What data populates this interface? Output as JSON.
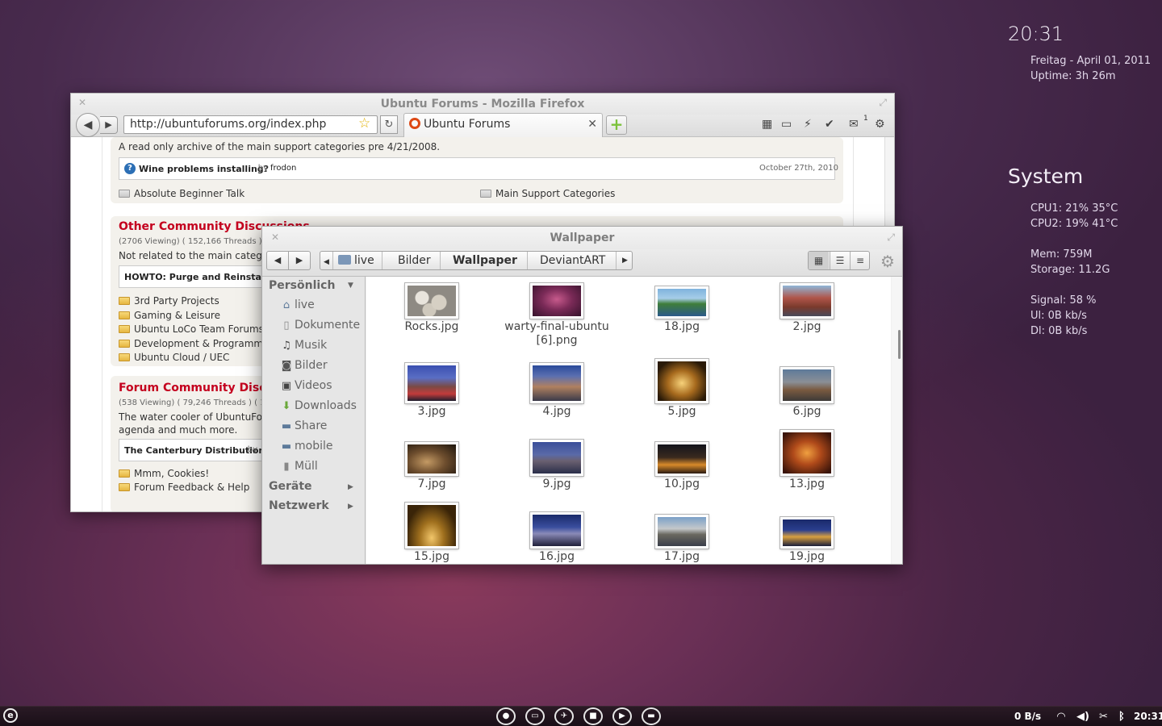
{
  "conky": {
    "clock": "20:31",
    "date": "Freitag - April 01, 2011",
    "uptime": "Uptime: 3h 26m",
    "system_title": "System",
    "cpu1": "CPU1: 21%  35°C",
    "cpu2": "CPU2: 19%  41°C",
    "mem": "Mem: 759M",
    "storage": "Storage: 11.2G",
    "signal": "Signal: 58  %",
    "ul": "Ul: 0B     kb/s",
    "dl": "Dl: 0B     kb/s"
  },
  "firefox": {
    "title": "Ubuntu Forums - Mozilla Firefox",
    "url": "http://ubuntuforums.org/index.php",
    "tab_label": "Ubuntu Forums",
    "mail_count": "1",
    "archive_desc": "A read only archive of the main support categories pre 4/21/2008.",
    "lastpost1_title": "Wine problems installing?",
    "lastpost1_by": " - by ",
    "lastpost1_user": "frodon",
    "lastpost1_date": "October 27th, 2010",
    "sub1": "Absolute Beginner Talk",
    "sub2": "Main Support Categories",
    "section2_title": "Other Community Discussions",
    "section2_stats": "(2706 Viewing) ( 152,166 Threads ) (",
    "section2_desc": "Not related to the main categ",
    "section2_post": "HOWTO: Purge and Reinstall...",
    "section2_post_by": " - ",
    "section2_subs": [
      "3rd Party Projects",
      "Gaming & Leisure",
      "Ubuntu LoCo Team Forums",
      "Development & Programming",
      "Ubuntu Cloud / UEC"
    ],
    "section3_title": "Forum Community Discus",
    "section3_stats": "(538 Viewing) ( 79,246 Threads ) ( 1",
    "section3_desc1": "The water cooler of UbuntuFo",
    "section3_desc2": "agenda and much more.",
    "section3_post": "The Canterbury Distribution",
    "section3_post_by": " - by",
    "section3_subs": [
      "Mmm, Cookies!",
      "Forum Feedback & Help"
    ]
  },
  "nautilus": {
    "title": "Wallpaper",
    "breadcrumbs": [
      "live",
      "Bilder",
      "Wallpaper",
      "DeviantART"
    ],
    "sidebar": {
      "personal_header": "Persönlich",
      "items": [
        "live",
        "Dokumente",
        "Musik",
        "Bilder",
        "Videos",
        "Downloads",
        "Share",
        "mobile",
        "Müll"
      ],
      "devices_header": "Geräte",
      "network_header": "Netzwerk"
    },
    "files": [
      "Rocks.jpg",
      "warty-final-ubuntu [6].png",
      "18.jpg",
      "2.jpg",
      "3.jpg",
      "4.jpg",
      "5.jpg",
      "6.jpg",
      "7.jpg",
      "9.jpg",
      "10.jpg",
      "13.jpg",
      "15.jpg",
      "16.jpg",
      "17.jpg",
      "19.jpg"
    ],
    "file_line2": "[6].png"
  },
  "taskbar": {
    "net_speed": "0 B/s",
    "clock": "20:31"
  }
}
